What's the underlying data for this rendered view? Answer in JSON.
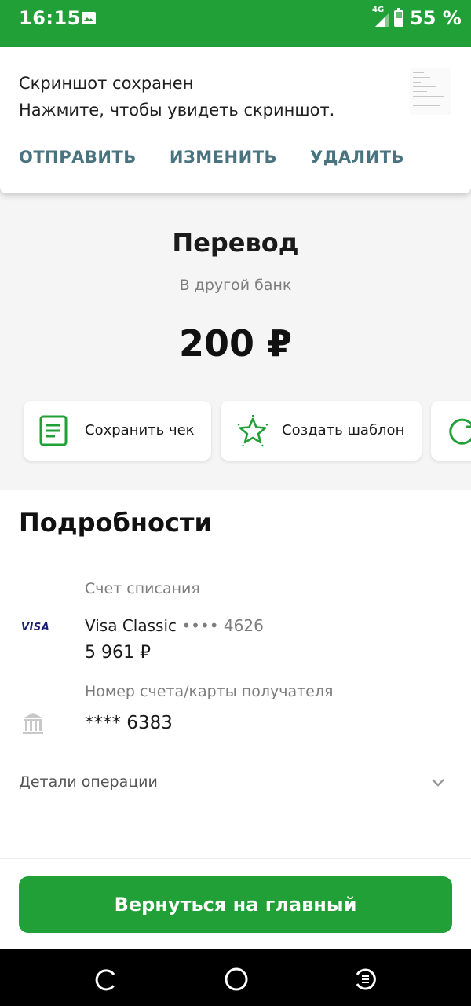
{
  "status_bar": {
    "time": "16:15",
    "network": "4G",
    "battery": "55 %",
    "battery_level": 55
  },
  "notification": {
    "title": "Скриншот сохранен",
    "body": "Нажмите, чтобы увидеть скриншот.",
    "actions": [
      "ОТПРАВИТЬ",
      "ИЗМЕНИТЬ",
      "УДАЛИТЬ"
    ]
  },
  "operation": {
    "title": "Перевод",
    "subtitle": "В другой банк",
    "amount": "200 ₽"
  },
  "action_cards": [
    {
      "label": "Сохранить чек",
      "icon": "receipt-icon"
    },
    {
      "label": "Создать шаблон",
      "icon": "star-icon"
    },
    {
      "label": "",
      "icon": "repeat-icon"
    }
  ],
  "details": {
    "heading": "Подробности",
    "debit_label": "Счет списания",
    "card_logo": "VISA",
    "card_name": "Visa Classic",
    "card_mask": "•••• 4626",
    "card_balance": "5 961 ₽",
    "recipient_label": "Номер счета/карты получателя",
    "recipient_number": "**** 6383",
    "operation_details": "Детали операции"
  },
  "main_button": "Вернуться на главный",
  "colors": {
    "brand": "#21a038",
    "notif_action": "#48737f",
    "muted_text": "#7d7d7d"
  }
}
